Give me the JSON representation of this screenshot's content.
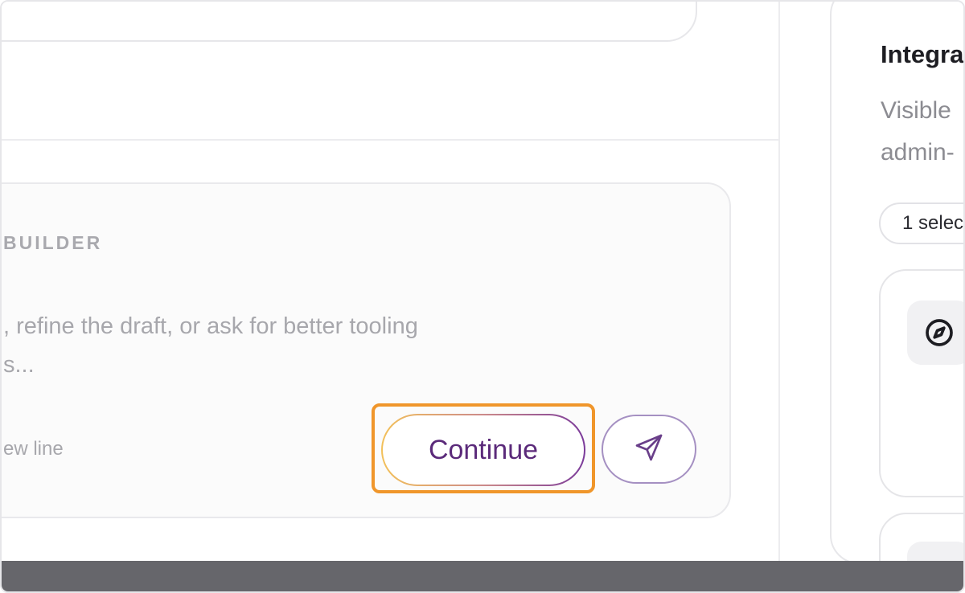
{
  "composer": {
    "label": "BUILDER",
    "placeholder_line1": ", refine the draft, or ask for better tooling",
    "placeholder_line2": "s...",
    "hint": "ew line",
    "continue_label": "Continue"
  },
  "sidebar": {
    "title": "Integra",
    "description_line1": "Visible",
    "description_line2": "admin-",
    "selection_label": "1 selec"
  },
  "icons": {
    "send": "send-icon",
    "compass": "compass-icon"
  },
  "colors": {
    "highlight": "#f0962b",
    "accent": "#5b2a7a",
    "bottom_bar": "#66666b"
  }
}
